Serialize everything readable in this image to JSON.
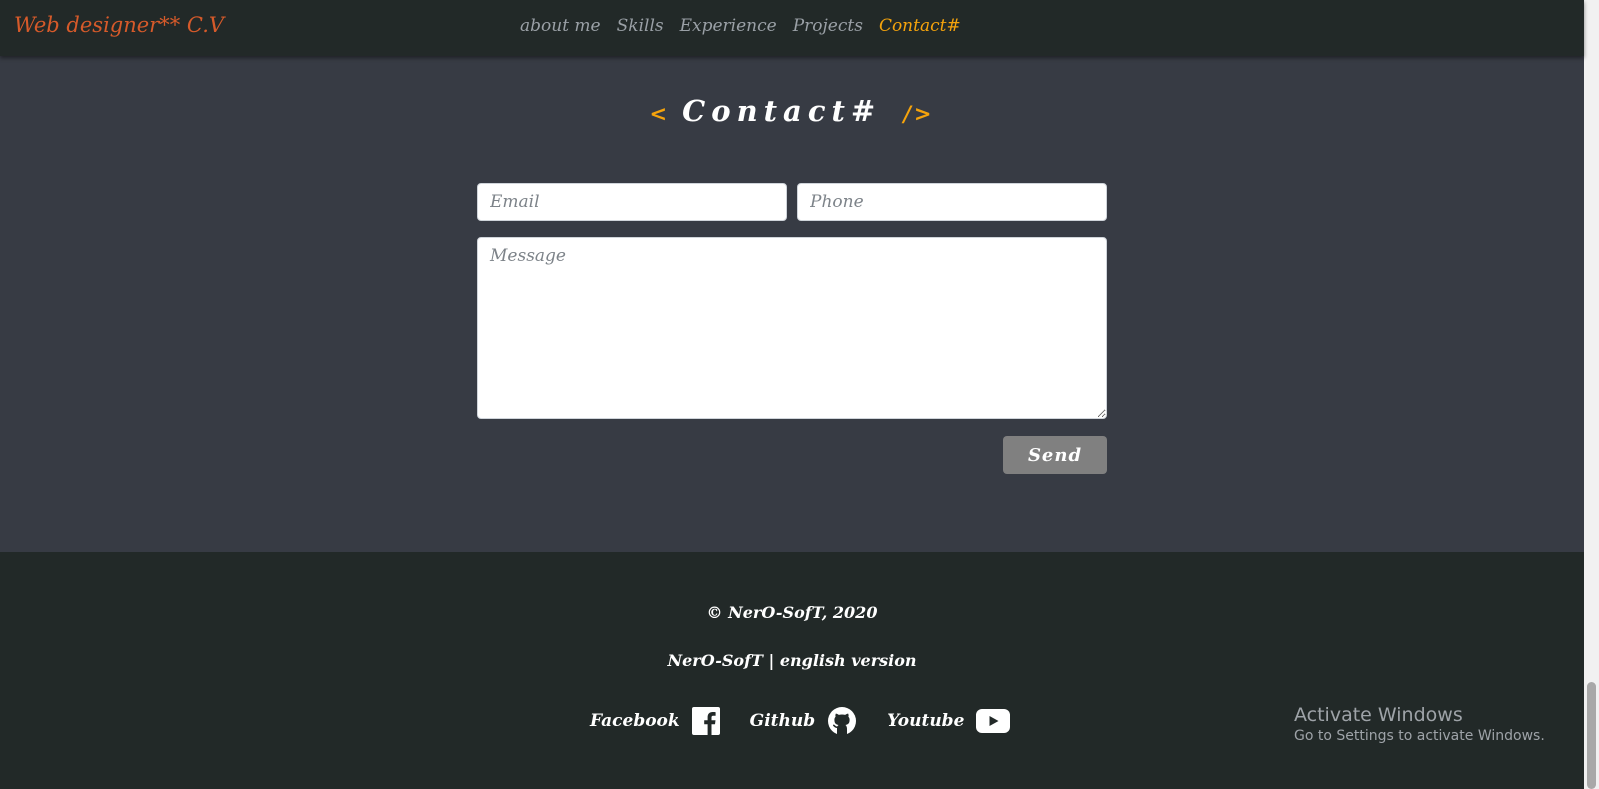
{
  "brand": "Web designer** C.V",
  "nav": [
    {
      "label": "about me",
      "active": false
    },
    {
      "label": "Skills",
      "active": false
    },
    {
      "label": "Experience",
      "active": false
    },
    {
      "label": "Projects",
      "active": false
    },
    {
      "label": "Contact#",
      "active": true
    }
  ],
  "section": {
    "open_bracket": "<",
    "title": "Contact#",
    "close_bracket": "/>"
  },
  "form": {
    "email_placeholder": "Email",
    "phone_placeholder": "Phone",
    "message_placeholder": "Message",
    "send_label": "Send"
  },
  "footer": {
    "copyright": "© NerO-SofT, 2020",
    "tagline": "NerO-SofT | english version",
    "social": [
      {
        "label": "Facebook",
        "icon": "facebook-icon"
      },
      {
        "label": "Github",
        "icon": "github-icon"
      },
      {
        "label": "Youtube",
        "icon": "youtube-icon"
      }
    ]
  },
  "windows_notice": {
    "title": "Activate Windows",
    "subtitle": "Go to Settings to activate Windows."
  },
  "colors": {
    "page_bg": "#373b44",
    "nav_bg": "#222928",
    "accent": "#f5a30c",
    "brand": "#d65a2a",
    "nav_link": "#9aa0a6",
    "button": "#808080"
  }
}
